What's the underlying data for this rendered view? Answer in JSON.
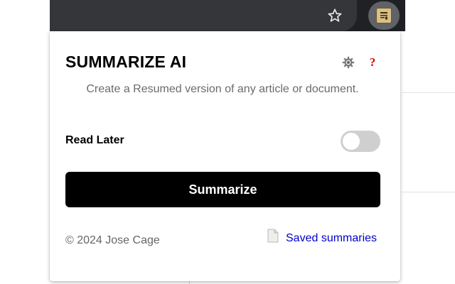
{
  "browser": {
    "star_icon": "star-outline-icon",
    "extension_icon": "summarize-ai-extension-icon"
  },
  "popup": {
    "title": "SUMMARIZE AI",
    "settings_icon": "gear-icon",
    "help_glyph": "?",
    "help_color": "#d40000",
    "subtitle": "Create a Resumed version of any article or document.",
    "read_later": {
      "label": "Read Later",
      "enabled": false
    },
    "summarize_button": "Summarize",
    "footer": {
      "copyright": "© 2024 Jose Cage",
      "saved_link": "Saved summaries",
      "saved_icon": "document-icon",
      "link_color": "#0000cc"
    }
  }
}
